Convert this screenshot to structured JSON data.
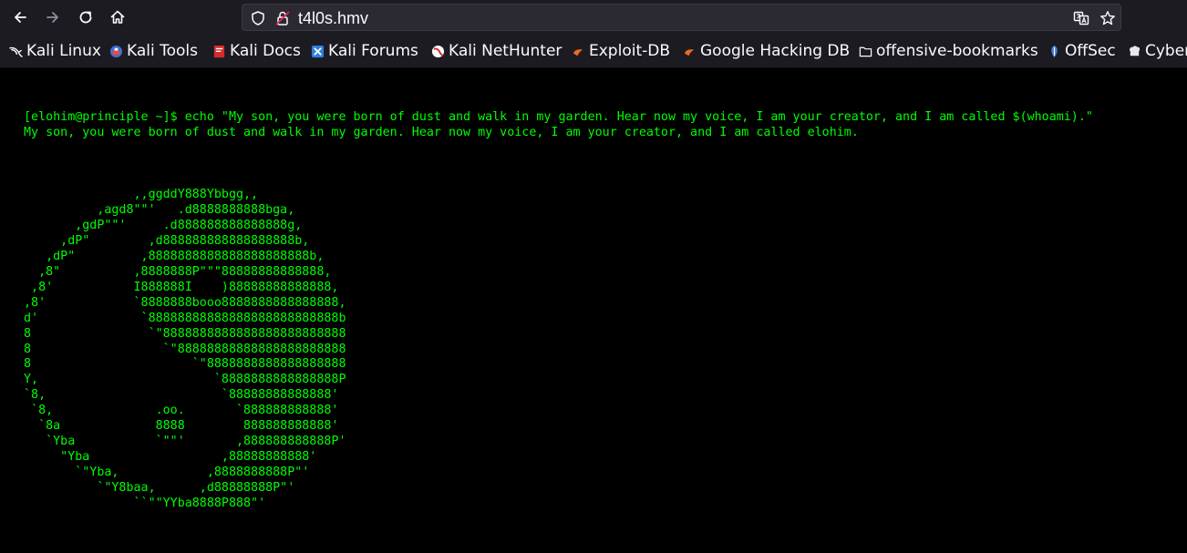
{
  "browser": {
    "url": "t4l0s.hmv",
    "nav": {
      "back_icon": "arrow-left-icon",
      "forward_icon": "arrow-right-icon",
      "reload_icon": "reload-icon",
      "home_icon": "home-icon"
    },
    "bookmarks": [
      {
        "label": "Kali Linux",
        "icon": "kali-dragon-icon"
      },
      {
        "label": "Kali Tools",
        "icon": "kali-tools-icon"
      },
      {
        "label": "Kali Docs",
        "icon": "kali-docs-icon"
      },
      {
        "label": "Kali Forums",
        "icon": "kali-forums-icon"
      },
      {
        "label": "Kali NetHunter",
        "icon": "kali-nethunter-icon"
      },
      {
        "label": "Exploit-DB",
        "icon": "exploit-db-icon"
      },
      {
        "label": "Google Hacking DB",
        "icon": "ghdb-icon"
      },
      {
        "label": "offensive-bookmarks",
        "icon": "folder-icon"
      },
      {
        "label": "OffSec",
        "icon": "offsec-icon"
      },
      {
        "label": "Cyber",
        "icon": "cyberchef-icon"
      }
    ],
    "colors": {
      "chrome_bg": "#1c1b22",
      "urlbar_bg": "#2b2a33",
      "page_bg": "#000000",
      "terminal_green": "#00ff00"
    }
  },
  "terminal": {
    "command_line": "[elohim@principle ~]$ echo \"My son, you were born of dust and walk in my garden. Hear now my voice, I am your creator, and I am called $(whoami).\"",
    "output_line": "My son, you were born of dust and walk in my garden. Hear now my voice, I am your creator, and I am called elohim.",
    "ascii_art": "               ,,ggddY888Ybbgg,,\n          ,agd8\"\"'   .d8888888888bga,\n       ,gdP\"\"'     .d888888888888888g,\n     ,dP\"        ,d888888888888888888b,\n   ,dP\"         ,8888888888888888888888b,\n  ,8\"          ,8888888P\"\"\"88888888888888,\n ,8'           I888888I    )88888888888888,\n,8'            `8888888booo8888888888888888,\nd'              `88888888888888888888888888b\n8                `\"8888888888888888888888888\n8                  `\"88888888888888888888888\n8                      `\"8888888888888888888\nY,                        `8888888888888888P\n`8,                        `88888888888888'\n `8,              .oo.       `888888888888'\n  `8a             8888        888888888888'\n   `Yba           `\"\"'       ,888888888888P'\n     \"Yba                  ,88888888888'\n       `\"Yba,            ,8888888888P\"'\n          `\"Y8baa,      ,d88888888P\"'\n               ``\"\"YYba8888P888\"'"
  }
}
